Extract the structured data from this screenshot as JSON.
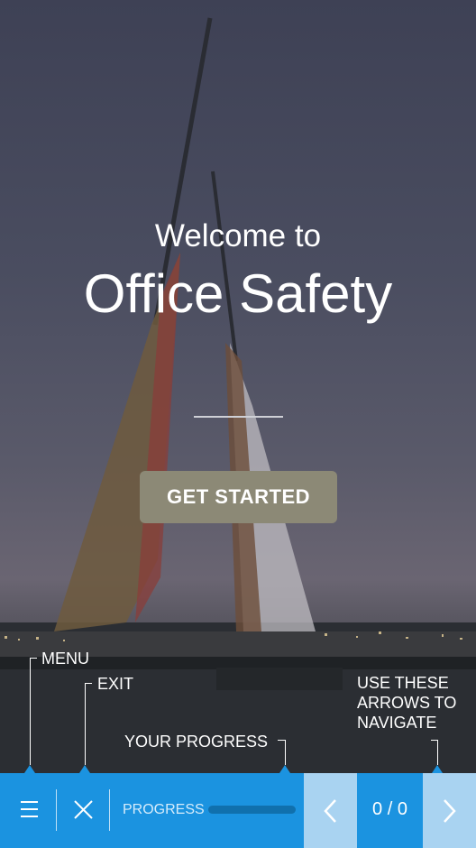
{
  "hero": {
    "welcome": "Welcome to",
    "title": "Office Safety",
    "cta_label": "GET STARTED"
  },
  "hints": {
    "menu": "MENU",
    "exit": "EXIT",
    "progress": "YOUR PROGRESS",
    "arrows_line1": "USE THESE",
    "arrows_line2": "ARROWS TO",
    "arrows_line3": "NAVIGATE"
  },
  "nav": {
    "progress_label": "PROGRESS",
    "progress_value": 0,
    "page_counter": "0 / 0"
  },
  "colors": {
    "bar": "#1b93e0",
    "arrow_button": "#a9d3f1",
    "cta": "#8c8976"
  }
}
